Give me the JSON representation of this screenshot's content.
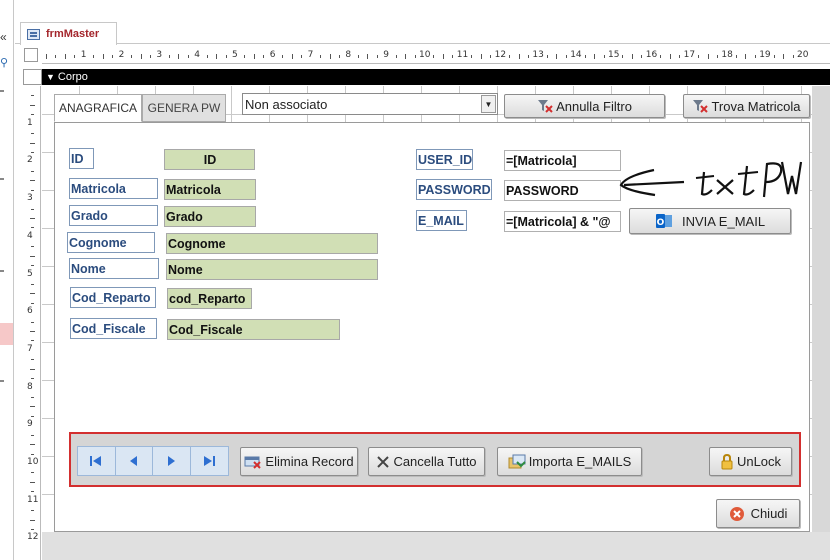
{
  "window": {
    "collapse_glyph": "«",
    "document_tab": "frmMaster"
  },
  "ruler": {
    "horizontal": [
      "1",
      "2",
      "3",
      "4",
      "5",
      "6",
      "7",
      "8",
      "9",
      "10",
      "11",
      "12",
      "13",
      "14",
      "15",
      "16",
      "17",
      "18",
      "19",
      "20"
    ],
    "vertical": [
      "1",
      "2",
      "3",
      "4",
      "5",
      "6",
      "7",
      "8",
      "9",
      "10",
      "11",
      "12"
    ]
  },
  "section": {
    "label": "Corpo"
  },
  "tabs": [
    "ANAGRAFICA",
    "GENERA PW"
  ],
  "filter": {
    "value": "Non associato",
    "annulla_label": "Annulla Filtro",
    "trova_label": "Trova Matricola"
  },
  "fields": [
    {
      "label": "ID",
      "control": "ID"
    },
    {
      "label": "Matricola",
      "control": "Matricola"
    },
    {
      "label": "Grado",
      "control": "Grado"
    },
    {
      "label": "Cognome",
      "control": "Cognome"
    },
    {
      "label": "Nome",
      "control": "Nome"
    },
    {
      "label": "Cod_Reparto",
      "control": "cod_Reparto"
    },
    {
      "label": "Cod_Fiscale",
      "control": "Cod_Fiscale"
    }
  ],
  "account": [
    {
      "label": "USER_ID",
      "control": "=[Matricola]"
    },
    {
      "label": "PASSWORD",
      "control": "PASSWORD"
    },
    {
      "label": "E_MAIL",
      "control": "=[Matricola] & \"@"
    }
  ],
  "email_button": "INVIA E_MAIL",
  "handwritten_note": "txtPW",
  "footer": {
    "elimina": "Elimina Record",
    "cancella": "Cancella Tutto",
    "importa": "Importa E_MAILS",
    "unlock": "UnLock",
    "chiudi": "Chiudi"
  },
  "colors": {
    "bound_field": "#d1dfb5",
    "label_text": "#2b4c7e",
    "panel_border": "#d32f2f",
    "document_tab": "#a4262c"
  },
  "icons": [
    "first-record-icon",
    "previous-record-icon",
    "next-record-icon",
    "last-record-icon",
    "delete-record-icon",
    "clear-icon",
    "import-icon",
    "lock-icon",
    "close-icon",
    "outlook-icon",
    "filter-icon",
    "dropdown-arrow-icon"
  ]
}
